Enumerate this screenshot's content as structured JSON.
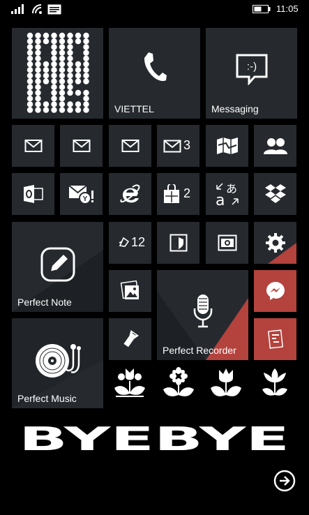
{
  "status": {
    "time": "11:05",
    "icons": [
      "signal-icon",
      "wifi-icon",
      "message-icon",
      "battery-icon"
    ]
  },
  "tiles": {
    "clock_text": "00 05",
    "phone_label": "VIETTEL",
    "messaging_label": "Messaging",
    "messaging_glyph": ":-)",
    "mail4_count": "3",
    "store_count": "2",
    "notify_count": "12",
    "perfect_note": "Perfect Note",
    "perfect_music": "Perfect Music",
    "perfect_recorder": "Perfect Recorder"
  },
  "colors": {
    "tile": "#262a2f",
    "accent_red": "#b4423d"
  },
  "footer": {
    "text": "BYEBYE",
    "arrow_icon": "arrow-right-circle-icon"
  }
}
